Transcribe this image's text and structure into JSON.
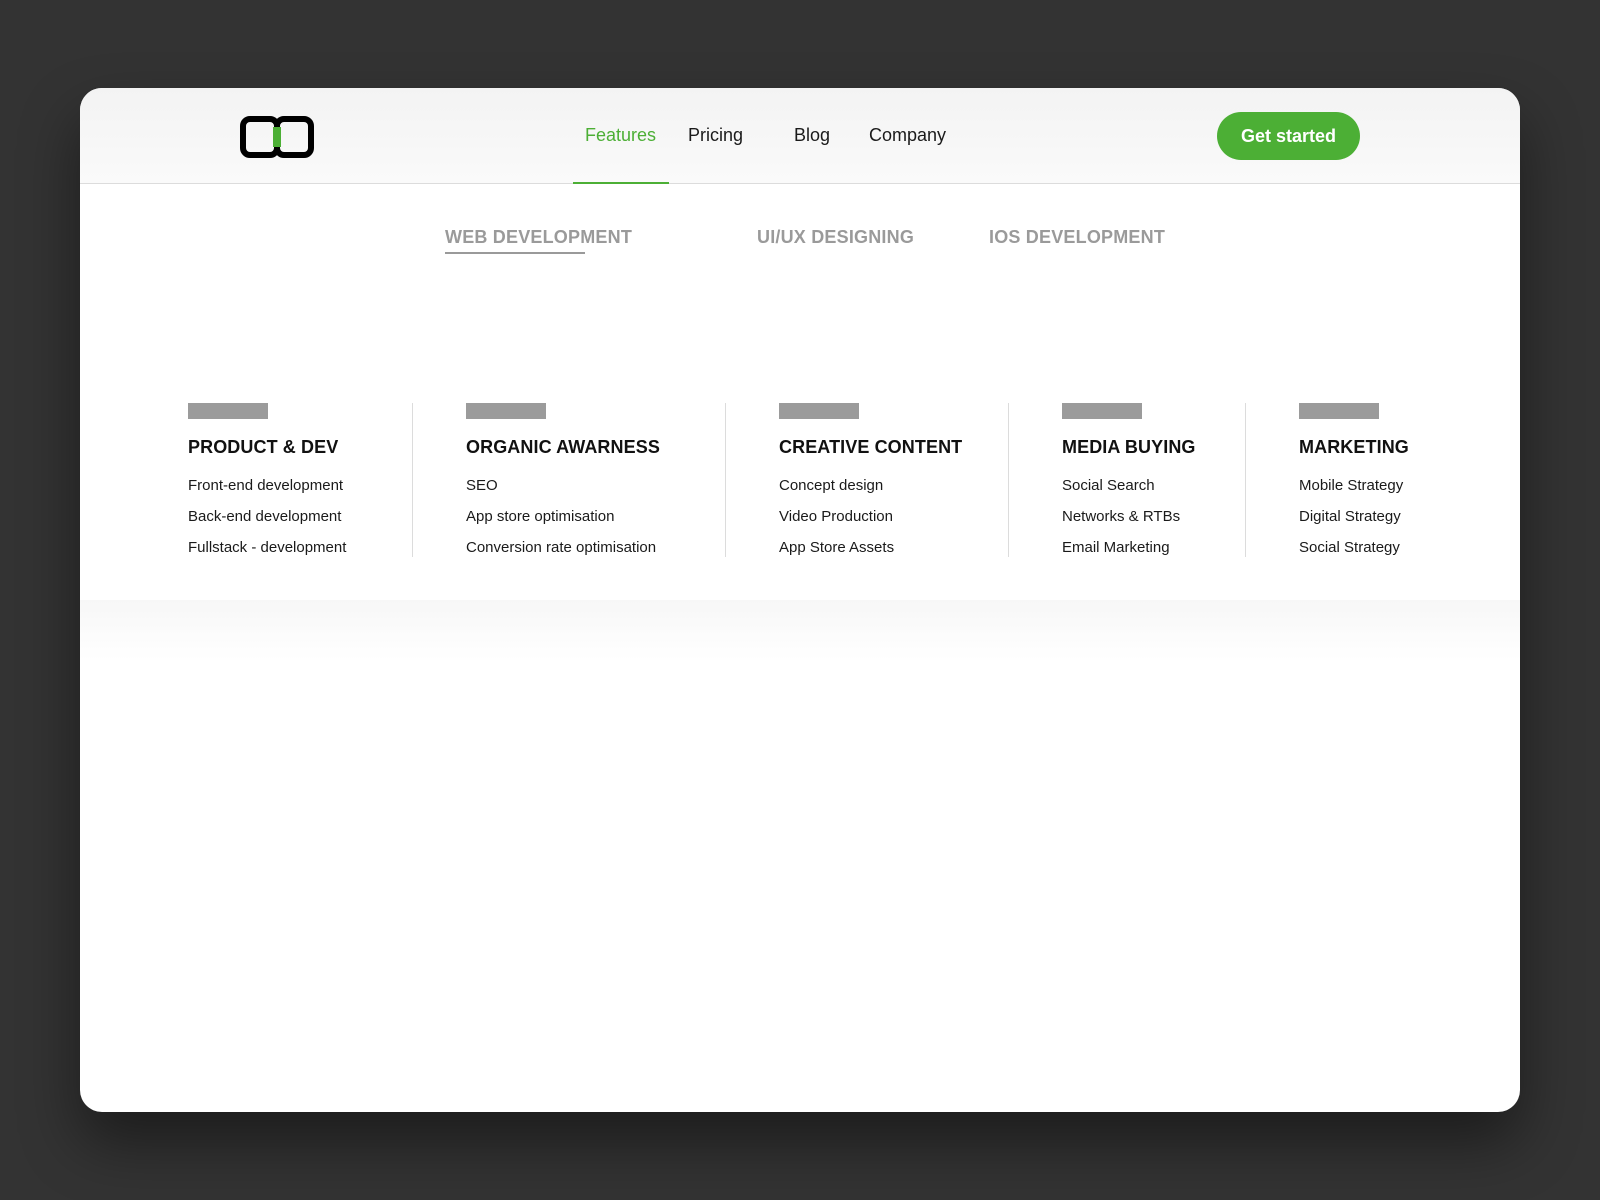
{
  "colors": {
    "accent": "#4caf35",
    "background": "#333333",
    "muted": "#9a9a9a",
    "text": "#1a1a1a"
  },
  "logo": {
    "icon": "logo-mark-icon"
  },
  "nav": {
    "items": [
      {
        "label": "Features",
        "active": true
      },
      {
        "label": "Pricing",
        "active": false
      },
      {
        "label": "Blog",
        "active": false
      },
      {
        "label": "Company",
        "active": false
      }
    ],
    "cta_label": "Get started"
  },
  "mega_menu": {
    "tabs": [
      {
        "label": "WEB DEVELOPMENT",
        "active": true
      },
      {
        "label": "UI/UX DESIGNING",
        "active": false
      },
      {
        "label": "IOS DEVELOPMENT",
        "active": false
      }
    ],
    "columns": [
      {
        "title": "PRODUCT & DEV",
        "links": [
          "Front-end development",
          "Back-end development",
          "Fullstack - development"
        ]
      },
      {
        "title": "ORGANIC AWARNESS",
        "links": [
          "SEO",
          "App store optimisation",
          "Conversion rate optimisation"
        ]
      },
      {
        "title": "CREATIVE CONTENT",
        "links": [
          "Concept design",
          "Video Production",
          "App Store Assets"
        ]
      },
      {
        "title": "MEDIA BUYING",
        "links": [
          "Social Search",
          "Networks & RTBs",
          "Email Marketing"
        ]
      },
      {
        "title": "MARKETING",
        "links": [
          "Mobile Strategy",
          "Digital Strategy",
          "Social Strategy"
        ]
      }
    ]
  }
}
